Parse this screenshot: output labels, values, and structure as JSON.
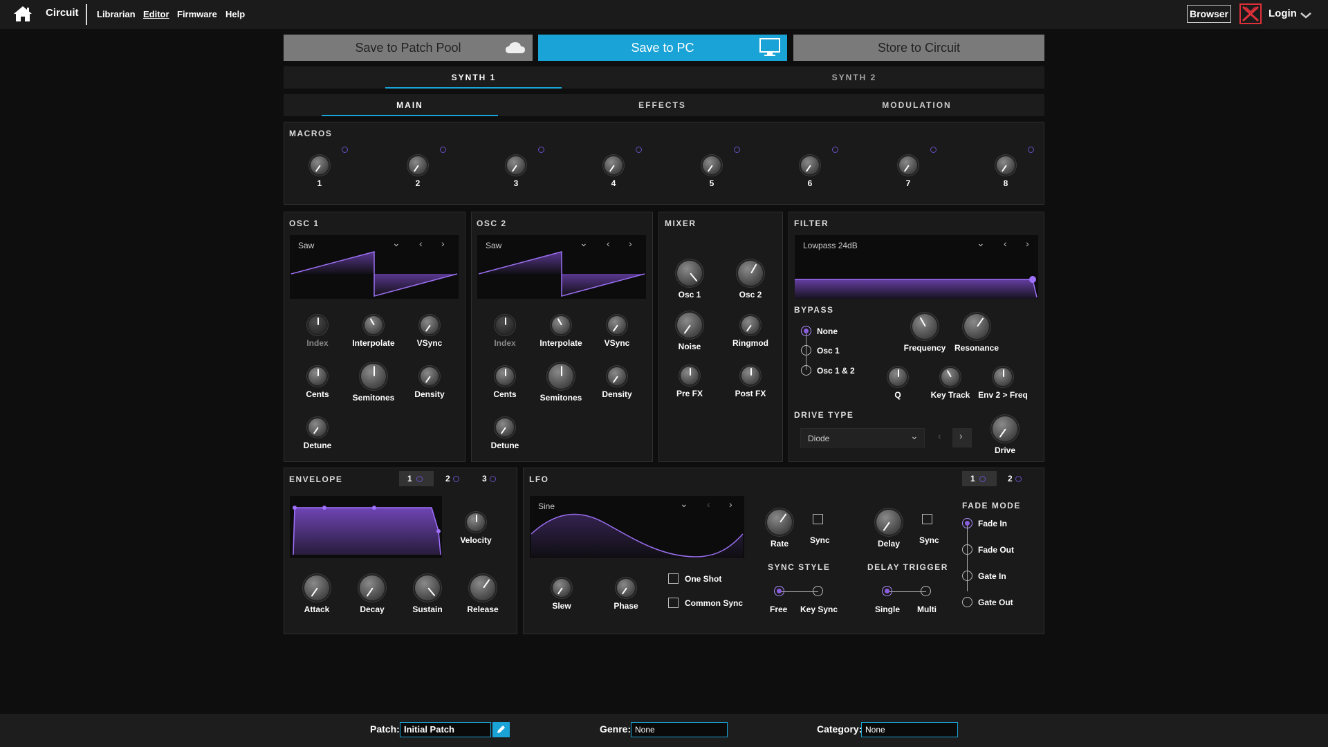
{
  "topbar": {
    "brand": "Circuit",
    "nav": [
      "Librarian",
      "Editor",
      "Firmware",
      "Help"
    ],
    "browser": "Browser",
    "login": "Login"
  },
  "actions": {
    "save_pool": "Save to Patch Pool",
    "save_pc": "Save to PC",
    "store": "Store to Circuit"
  },
  "synth_tabs": [
    "SYNTH 1",
    "SYNTH 2"
  ],
  "section_tabs": [
    "MAIN",
    "EFFECTS",
    "MODULATION"
  ],
  "macros": {
    "title": "MACROS",
    "labels": [
      "1",
      "2",
      "3",
      "4",
      "5",
      "6",
      "7",
      "8"
    ]
  },
  "osc1": {
    "title": "OSC 1",
    "waveform": "Saw",
    "knobs": [
      "Index",
      "Interpolate",
      "VSync",
      "Cents",
      "Semitones",
      "Density",
      "Detune"
    ]
  },
  "osc2": {
    "title": "OSC 2",
    "waveform": "Saw",
    "knobs": [
      "Index",
      "Interpolate",
      "VSync",
      "Cents",
      "Semitones",
      "Density",
      "Detune"
    ]
  },
  "mixer": {
    "title": "MIXER",
    "knobs": [
      "Osc 1",
      "Osc 2",
      "Noise",
      "Ringmod",
      "Pre FX",
      "Post FX"
    ]
  },
  "filter": {
    "title": "FILTER",
    "type": "Lowpass 24dB",
    "bypass_title": "BYPASS",
    "bypass_options": [
      "None",
      "Osc 1",
      "Osc 1 & 2"
    ],
    "bypass_selected": "None",
    "knobs": [
      "Frequency",
      "Resonance",
      "Q",
      "Key Track",
      "Env 2 > Freq",
      "Drive"
    ],
    "drive_type_title": "DRIVE TYPE",
    "drive_type": "Diode"
  },
  "envelope": {
    "title": "ENVELOPE",
    "tabs": [
      "1",
      "2",
      "3"
    ],
    "selected_tab": "1",
    "knobs": [
      "Velocity",
      "Attack",
      "Decay",
      "Sustain",
      "Release"
    ]
  },
  "lfo": {
    "title": "LFO",
    "tabs": [
      "1",
      "2"
    ],
    "selected_tab": "1",
    "waveform": "Sine",
    "knobs": [
      "Slew",
      "Phase",
      "Rate",
      "Delay"
    ],
    "checkboxes": [
      "One Shot",
      "Common Sync"
    ],
    "sync_labels": [
      "Sync",
      "Sync"
    ],
    "sync_style_title": "SYNC STYLE",
    "sync_style_options": [
      "Free",
      "Key Sync"
    ],
    "sync_style_selected": "Free",
    "delay_trigger_title": "DELAY TRIGGER",
    "delay_trigger_options": [
      "Single",
      "Multi"
    ],
    "delay_trigger_selected": "Single",
    "fade_mode_title": "FADE MODE",
    "fade_mode_options": [
      "Fade In",
      "Fade Out",
      "Gate In",
      "Gate Out"
    ],
    "fade_mode_selected": "Fade In"
  },
  "footer": {
    "patch_label": "Patch:",
    "patch_value": "Initial Patch",
    "genre_label": "Genre:",
    "genre_value": "None",
    "category_label": "Category:",
    "category_value": "None"
  },
  "colors": {
    "accent": "#1aa3d6",
    "purple": "#8a5ce0",
    "panel": "#1a1a1a",
    "background": "#0e0e0e"
  }
}
